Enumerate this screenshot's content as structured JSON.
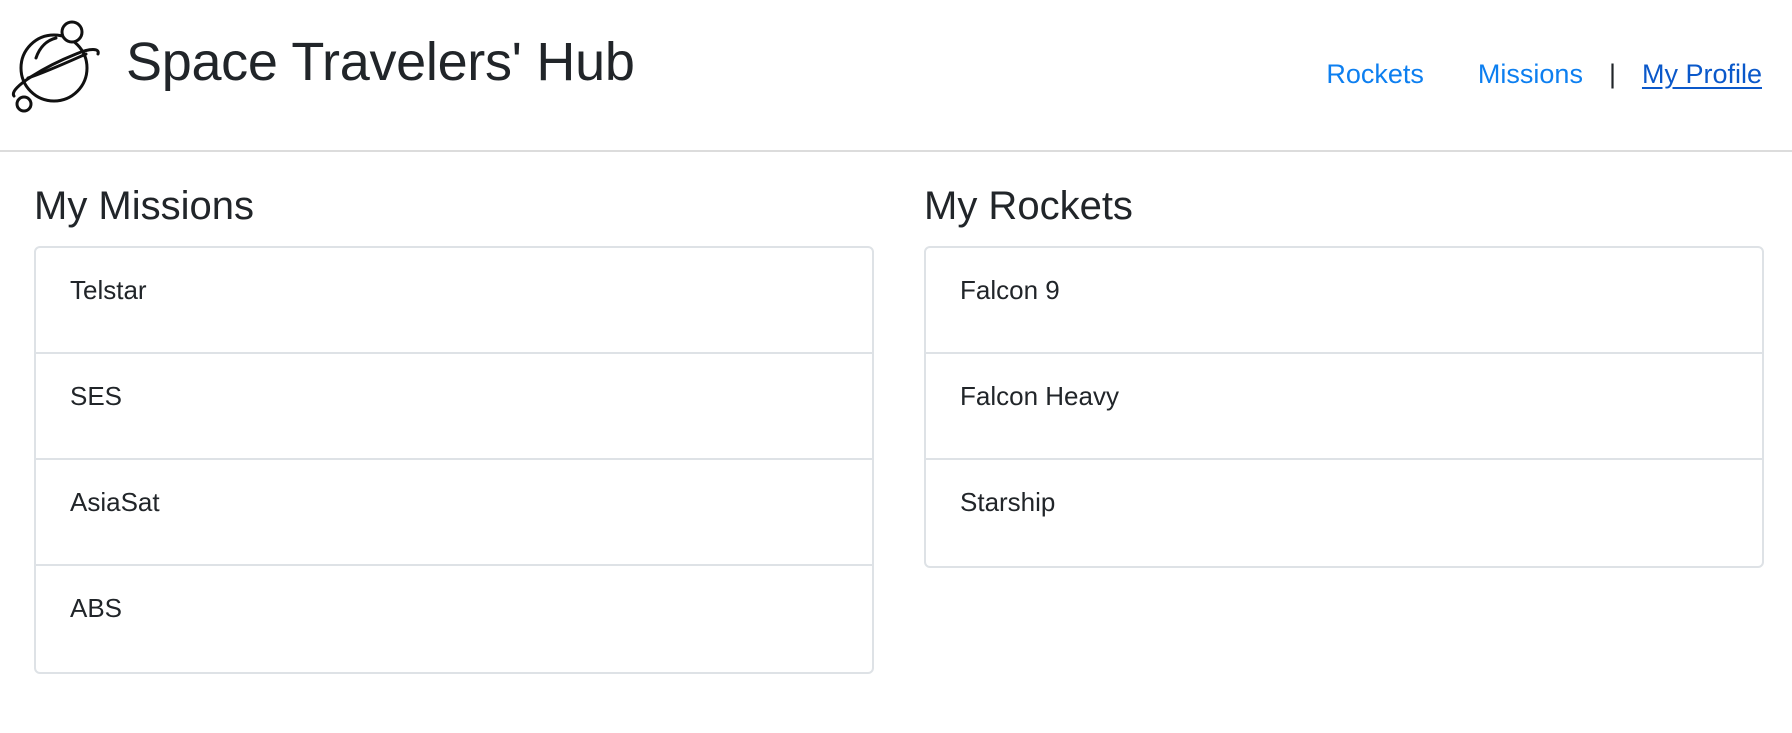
{
  "header": {
    "title": "Space Travelers' Hub",
    "logo_icon": "planet-icon",
    "nav": {
      "rockets": "Rockets",
      "missions": "Missions",
      "separator": "|",
      "profile": "My Profile"
    }
  },
  "missions": {
    "heading": "My Missions",
    "items": [
      "Telstar",
      "SES",
      "AsiaSat",
      "ABS"
    ]
  },
  "rockets": {
    "heading": "My Rockets",
    "items": [
      "Falcon 9",
      "Falcon Heavy",
      "Starship"
    ]
  },
  "colors": {
    "link": "#0d7ff0",
    "active_link": "#0a58ca",
    "text": "#212529",
    "border": "#dee2e6"
  }
}
